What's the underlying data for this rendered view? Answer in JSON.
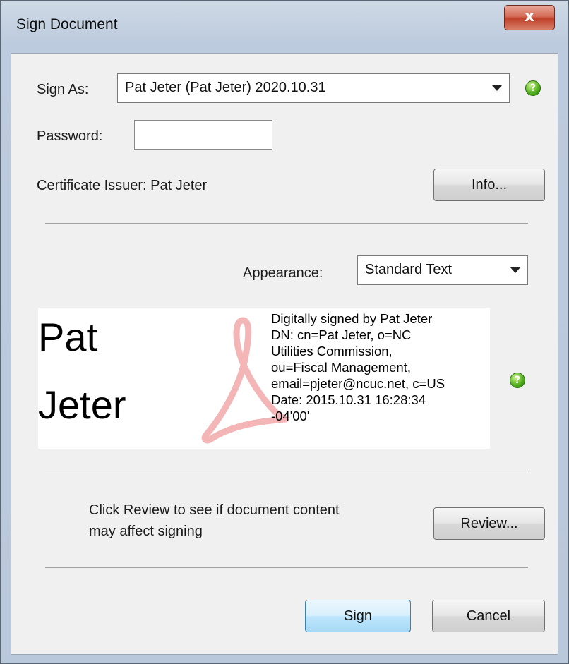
{
  "window": {
    "title": "Sign Document",
    "close_glyph": "x"
  },
  "sign_as": {
    "label": "Sign As:",
    "selected": "Pat Jeter (Pat Jeter) 2020.10.31"
  },
  "password": {
    "label": "Password:",
    "value": ""
  },
  "certificate": {
    "issuer_text": "Certificate Issuer: Pat Jeter",
    "info_button": "Info..."
  },
  "appearance": {
    "label": "Appearance:",
    "selected": "Standard Text"
  },
  "preview": {
    "name_line1": "Pat",
    "name_line2": "Jeter",
    "details": [
      "Digitally signed by Pat Jeter",
      "DN: cn=Pat Jeter, o=NC",
      "Utilities Commission,",
      "ou=Fiscal Management,",
      "email=pjeter@ncuc.net, c=US",
      "Date: 2015.10.31 16:28:34",
      "-04'00'"
    ],
    "watermark_icon": "adobe-acrobat-logo",
    "watermark_color": "#f3b5b5"
  },
  "review": {
    "text_line1": "Click Review to see if document content",
    "text_line2": "may affect signing",
    "button": "Review..."
  },
  "actions": {
    "sign": "Sign",
    "cancel": "Cancel"
  },
  "help_glyph": "?",
  "colors": {
    "help_green": "#4fae1c",
    "close_red": "#c0412a",
    "default_button_border": "#3c7fb1"
  }
}
